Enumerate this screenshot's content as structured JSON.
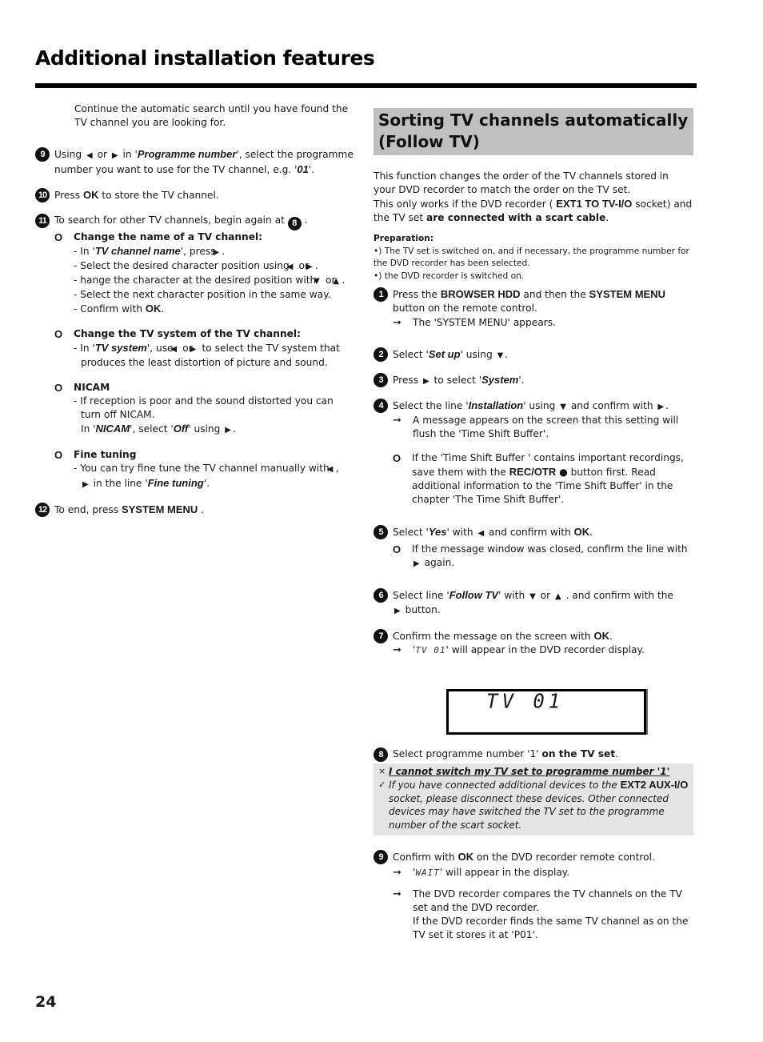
{
  "page": {
    "title": "Additional installation features",
    "page_number": "24"
  },
  "left": {
    "intro": "Continue the automatic search until you have found the TV channel you are looking for.",
    "step9": {
      "num": "9",
      "t1": "Using",
      "t2": "or",
      "t3": "in '",
      "menu": "Programme number",
      "t4": "', select the programme number you want to use for the TV channel, e.g. '",
      "val": "01",
      "t5": "'."
    },
    "step10": {
      "num": "10",
      "t1": "Press",
      "key": "OK",
      "t2": "to store the TV channel."
    },
    "step11": {
      "num": "11",
      "t1": "To search for other TV channels, begin again at",
      "ref": "8",
      "t2": "."
    },
    "opt_name": {
      "mark": "O",
      "title": "Change the name of a TV channel:",
      "l1a": "- In '",
      "l1m": "TV channel name",
      "l1b": "', press",
      "l2a": "- Select the desired character position using",
      "l2b": "or",
      "l3a": "- hange the character at the desired position with",
      "l3b": "or",
      "l4": "- Select the next character position in the same way.",
      "l5a": "- Confirm with",
      "l5k": "OK"
    },
    "opt_system": {
      "mark": "O",
      "title": "Change the TV system of the TV channel:",
      "l1a": "- In '",
      "l1m": "TV system",
      "l1b": "', use",
      "l1c": "or",
      "l1d": "to select the TV system that produces the least distortion of picture and sound."
    },
    "opt_nicam": {
      "mark": "O",
      "title": "NICAM",
      "l1": "- If reception is poor and the sound distorted you can turn off NICAM.",
      "l2a": "In '",
      "l2m": "NICAM",
      "l2b": "', select '",
      "l2v": "Off",
      "l2c": "' using"
    },
    "opt_fine": {
      "mark": "O",
      "title": "Fine tuning",
      "l1a": "- You can try fine tune the TV channel manually with",
      "l1b": ",",
      "l1c": "in the line '",
      "l1m": "Fine tuning",
      "l1d": "'."
    },
    "step12": {
      "num": "12",
      "t1": "To end, press",
      "key": "SYSTEM MENU",
      "t2": "."
    }
  },
  "right": {
    "section_title": "Sorting TV channels automatically (Follow TV)",
    "intro1": "This function changes the order of the TV channels stored in your DVD recorder to match the order on the TV set.",
    "intro2a": "This only works if the DVD recorder (",
    "intro2k": "EXT1 TO TV-I/O",
    "intro2b": "socket) and the TV set",
    "intro2c": "are connected with a scart cable",
    "intro2d": ".",
    "prep_title": "Preparation:",
    "prep1": "•) The TV set is switched on, and if necessary, the programme number for the DVD recorder has been selected.",
    "prep2": "•) the DVD recorder is switched on.",
    "step1": {
      "num": "1",
      "t1": "Press the",
      "k1": "BROWSER HDD",
      "t2": "and then the",
      "k2": "SYSTEM MENU",
      "t3": "button on the remote control.",
      "res": "The 'SYSTEM MENU' appears."
    },
    "step2": {
      "num": "2",
      "t1": "Select '",
      "menu": "Set up",
      "t2": "' using"
    },
    "step3": {
      "num": "3",
      "t1": "Press",
      "t2": "to select '",
      "menu": "System",
      "t3": "'."
    },
    "step4": {
      "num": "4",
      "t1": "Select the line '",
      "menu": "Installation",
      "t2": "' using",
      "t3": "and confirm with",
      "res": "A message appears on the screen that this setting will flush the 'Time Shift Buffer'.",
      "note_mark": "O",
      "note1": "If the 'Time Shift Buffer ' contains important recordings, save them with the",
      "note_key": "REC/OTR",
      "note2": "button first. Read additional information to the 'Time Shift Buffer' in the chapter 'The Time Shift Buffer'."
    },
    "step5": {
      "num": "5",
      "t1": "Select '",
      "menu": "Yes",
      "t2": "' with",
      "t3": "and confirm with",
      "key": "OK",
      "note_mark": "O",
      "note1": "If the message window was closed, confirm the line with",
      "note2": "again."
    },
    "step6": {
      "num": "6",
      "t1": "Select line '",
      "menu": "Follow TV",
      "t2": "' with",
      "t3": "or",
      "t4": ". and confirm with the",
      "t5": "button."
    },
    "step7": {
      "num": "7",
      "t1": "Confirm the message on the screen with",
      "key": "OK",
      "res_a": "'",
      "res_lcd": "TV 01",
      "res_b": "' will appear in the DVD recorder display."
    },
    "display": {
      "text": "TV 01"
    },
    "step8": {
      "num": "8",
      "t1": "Select programme number '1'",
      "t2": "on the TV set",
      "t3": "."
    },
    "trouble": {
      "q_mark": "×",
      "question": "I cannot switch my TV set to programme number '1'",
      "a_mark": "✓",
      "a1": "If you have connected additional devices to the",
      "a_key": "EXT2 AUX-I/O",
      "a2": "socket, please disconnect these devices. Other connected devices may have switched the TV set to the programme number of the scart socket."
    },
    "step9": {
      "num": "9",
      "t1": "Confirm with",
      "key": "OK",
      "t2": "on the DVD recorder remote control.",
      "res1_a": "'",
      "res1_lcd": "WAIT",
      "res1_b": "' will appear in the display.",
      "res2": "The DVD recorder compares the TV channels on the TV set and the DVD recorder.",
      "res3": "If the DVD recorder finds the same TV channel as on the TV set it stores it at 'P01'."
    }
  },
  "icons": {
    "left": "◀",
    "right": "▶",
    "down": "▼",
    "up": "▲",
    "result_arrow": "➞",
    "record_dot": "●"
  }
}
